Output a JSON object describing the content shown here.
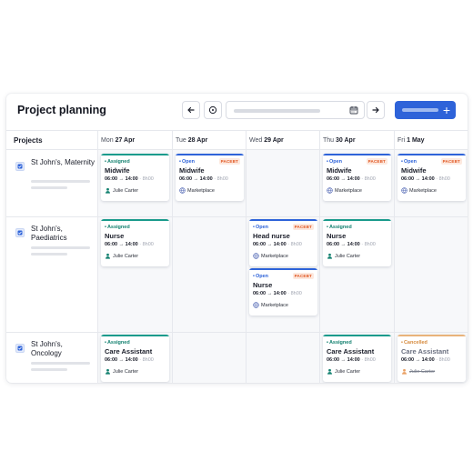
{
  "app": {
    "title": "Project planning",
    "add_button_icon": "plus-icon"
  },
  "header": {
    "projects_label": "Projects",
    "days": [
      {
        "dow": "Mon",
        "date": "27 Apr"
      },
      {
        "dow": "Tue",
        "date": "28 Apr"
      },
      {
        "dow": "Wed",
        "date": "29 Apr"
      },
      {
        "dow": "Thu",
        "date": "30 Apr"
      },
      {
        "dow": "Fri",
        "date": "1 May"
      }
    ]
  },
  "projects": [
    {
      "name": "St John's, Maternity"
    },
    {
      "name": "St John's, Paediatrics"
    },
    {
      "name": "St John's, Oncology"
    }
  ],
  "cards": [
    {
      "status": "Assigned",
      "role": "Midwife",
      "start": "06:00",
      "end": "14:00",
      "extra": "8h00",
      "who": "Julie Carter",
      "badge": ""
    },
    {
      "status": "Open",
      "role": "Midwife",
      "start": "06:00",
      "end": "14:00",
      "extra": "8h00",
      "who": "Marketplace",
      "badge": "PACEBT"
    },
    {
      "status": "Open",
      "role": "Midwife",
      "start": "06:00",
      "end": "14:00",
      "extra": "8h00",
      "who": "Marketplace",
      "badge": "PACEBT"
    },
    {
      "status": "Open",
      "role": "Midwife",
      "start": "06:00",
      "end": "14:00",
      "extra": "8h00",
      "who": "Marketplace",
      "badge": "PACEBT"
    },
    {
      "status": "Assigned",
      "role": "Nurse",
      "start": "06:00",
      "end": "14:00",
      "extra": "8h00",
      "who": "Julie Carter",
      "badge": ""
    },
    {
      "status": "Open",
      "role": "Head nurse",
      "start": "06:00",
      "end": "14:00",
      "extra": "8h00",
      "who": "Marketplace",
      "badge": "PACEBT"
    },
    {
      "status": "Assigned",
      "role": "Nurse",
      "start": "06:00",
      "end": "14:00",
      "extra": "8h00",
      "who": "Julie Carter",
      "badge": ""
    },
    {
      "status": "Open",
      "role": "Nurse",
      "start": "06:00",
      "end": "14:00",
      "extra": "8h00",
      "who": "Marketplace",
      "badge": "PACEBT"
    },
    {
      "status": "Assigned",
      "role": "Care Assistant",
      "start": "06:00",
      "end": "14:00",
      "extra": "8h00",
      "who": "Julie Carter",
      "badge": ""
    },
    {
      "status": "Assigned",
      "role": "Care Assistant",
      "start": "06:00",
      "end": "14:00",
      "extra": "8h00",
      "who": "Julie Carter",
      "badge": ""
    },
    {
      "status": "Cancelled",
      "role": "Care Assistant",
      "start": "06:00",
      "end": "14:00",
      "extra": "8h00",
      "who": "Julie Carter",
      "badge": ""
    }
  ],
  "colors": {
    "assigned": "#1a9b8c",
    "open": "#2e63d9",
    "cancelled": "#e9b37a",
    "accent": "#2e63d9"
  }
}
